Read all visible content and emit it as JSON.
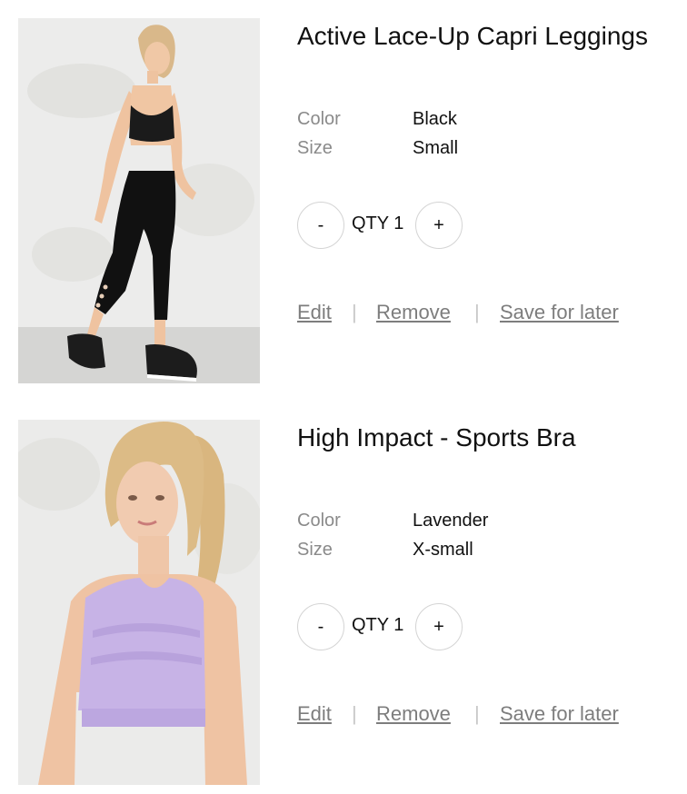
{
  "cart": {
    "items": [
      {
        "name": "Active Lace-Up Capri Leggings",
        "color_label": "Color",
        "color_value": "Black",
        "size_label": "Size",
        "size_value": "Small",
        "qty_minus": "-",
        "qty_text": "QTY 1",
        "qty_plus": "+",
        "edit": "Edit",
        "separator": "|",
        "remove": "Remove",
        "save_for_later": "Save for later"
      },
      {
        "name": "High Impact - Sports Bra",
        "color_label": "Color",
        "color_value": "Lavender",
        "size_label": "Size",
        "size_value": "X-small",
        "qty_minus": "-",
        "qty_text": "QTY 1",
        "qty_plus": "+",
        "edit": "Edit",
        "separator": "|",
        "remove": "Remove",
        "save_for_later": "Save for later"
      }
    ]
  },
  "colors": {
    "link": "#7d7d7d",
    "label": "#8a8a8a",
    "border": "#d4d4d4",
    "lavender": "#c7b3e6"
  }
}
